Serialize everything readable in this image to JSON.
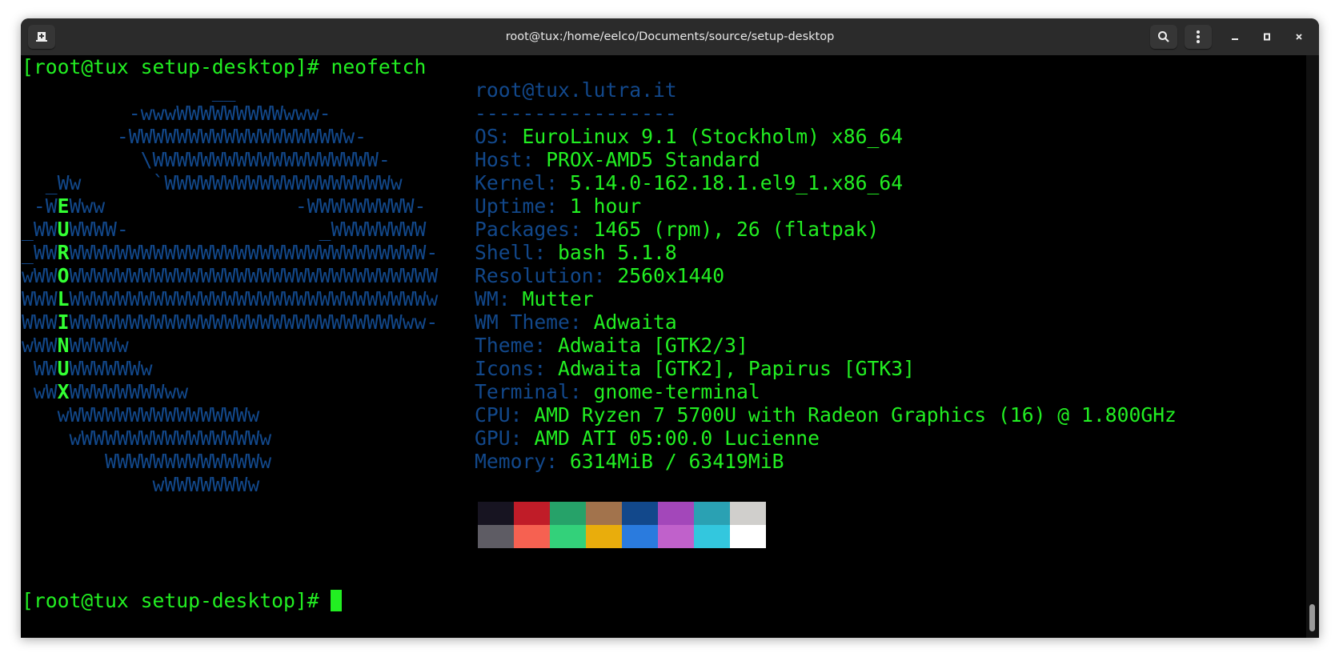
{
  "window": {
    "title": "root@tux:/home/eelco/Documents/source/setup-desktop",
    "icons": {
      "new_tab": "new-tab-icon",
      "search": "search-icon",
      "menu": "kebab-menu-icon",
      "minimize": "minimize-icon",
      "maximize": "maximize-icon",
      "close": "close-icon"
    }
  },
  "terminal": {
    "prompt": "[root@tux setup-desktop]# ",
    "command": "neofetch",
    "final_prompt": "[root@tux setup-desktop]# ",
    "colors": {
      "logo": "#12488b",
      "text": "#22ee22"
    },
    "logo_rows": [
      {
        "pre": "                __",
        "letter": "",
        "post": ""
      },
      {
        "pre": "         -wwwWWWWWWWWWwww-",
        "letter": "",
        "post": ""
      },
      {
        "pre": "        -WWWWWWWWWWWWWWWWWWw-",
        "letter": "",
        "post": ""
      },
      {
        "pre": "          \\WWWWWWWWWWWWWWWWWWW-",
        "letter": "",
        "post": ""
      },
      {
        "pre": "  _Ww      `WWWWWWWWWWWWWWWWWWWw",
        "letter": "",
        "post": ""
      },
      {
        "pre": " -W",
        "letter": "E",
        "post": "Www                -WWWWWWWWW-"
      },
      {
        "pre": "_WW",
        "letter": "U",
        "post": "WWWW-                _WWWWWWWW"
      },
      {
        "pre": "_WW",
        "letter": "R",
        "post": "WWWWWWWWWWWWWWWWWWWWWWWWWWWWWW-"
      },
      {
        "pre": "wWW",
        "letter": "O",
        "post": "WWWWWWWWWWWWWWWWWWWWWWWWWWWWWWW"
      },
      {
        "pre": "WWW",
        "letter": "L",
        "post": "WWWWWWWWWWWWWWWWWWWWWWWWWWWWWWw"
      },
      {
        "pre": "WWW",
        "letter": "I",
        "post": "WWWWWWWWWWWWWWWWWWWWWWWWWWWWww-"
      },
      {
        "pre": "wWW",
        "letter": "N",
        "post": "WWWWw"
      },
      {
        "pre": " WW",
        "letter": "U",
        "post": "WWWWWWw"
      },
      {
        "pre": " wW",
        "letter": "X",
        "post": "WWWWWWWWww"
      },
      {
        "pre": "   wWWWWWWWWWWWWWWWw",
        "letter": "",
        "post": ""
      },
      {
        "pre": "    wWWWWWWWWWWWWWWWw",
        "letter": "",
        "post": ""
      },
      {
        "pre": "       WWWWWWWWWWWWWw",
        "letter": "",
        "post": ""
      },
      {
        "pre": "           wWWWWWWWw",
        "letter": "",
        "post": ""
      }
    ],
    "info": {
      "user_host": "root@tux.lutra.it",
      "separator": "-----------------",
      "lines": [
        {
          "label": "OS:",
          "value": " EuroLinux 9.1 (Stockholm) x86_64"
        },
        {
          "label": "Host:",
          "value": " PROX-AMD5 Standard"
        },
        {
          "label": "Kernel:",
          "value": " 5.14.0-162.18.1.el9_1.x86_64"
        },
        {
          "label": "Uptime:",
          "value": " 1 hour"
        },
        {
          "label": "Packages:",
          "value": " 1465 (rpm), 26 (flatpak)"
        },
        {
          "label": "Shell:",
          "value": " bash 5.1.8"
        },
        {
          "label": "Resolution:",
          "value": " 2560x1440"
        },
        {
          "label": "WM:",
          "value": " Mutter"
        },
        {
          "label": "WM Theme:",
          "value": " Adwaita"
        },
        {
          "label": "Theme:",
          "value": " Adwaita [GTK2/3]"
        },
        {
          "label": "Icons:",
          "value": " Adwaita [GTK2], Papirus [GTK3]"
        },
        {
          "label": "Terminal:",
          "value": " gnome-terminal"
        },
        {
          "label": "CPU:",
          "value": " AMD Ryzen 7 5700U with Radeon Graphics (16) @ 1.800GHz"
        },
        {
          "label": "GPU:",
          "value": " AMD ATI 05:00.0 Lucienne"
        },
        {
          "label": "Memory:",
          "value": " 6314MiB / 63419MiB"
        }
      ],
      "palette_normal": [
        "#171421",
        "#c01c28",
        "#26a269",
        "#a2734c",
        "#12488b",
        "#a347ba",
        "#2aa1b3",
        "#d0cfcc"
      ],
      "palette_bright": [
        "#5e5c64",
        "#f66151",
        "#33d17a",
        "#e9ad0c",
        "#2a7bde",
        "#c061cb",
        "#33c7de",
        "#ffffff"
      ]
    }
  }
}
